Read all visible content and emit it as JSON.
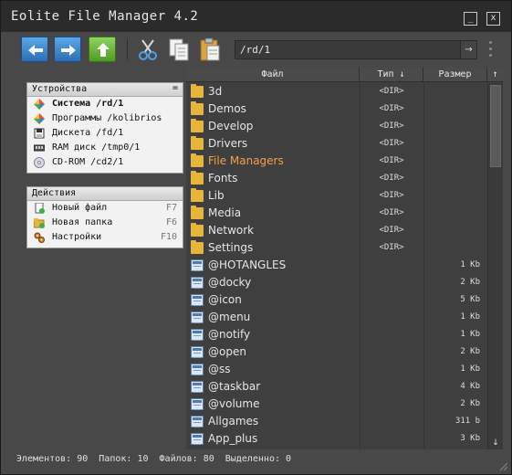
{
  "window": {
    "title": "Eolite File Manager 4.2",
    "minimize_label": "_",
    "close_label": "x"
  },
  "toolbar": {
    "path": "/rd/1",
    "go_label": "→"
  },
  "devices": {
    "header": "Устройства",
    "menu_label": "=",
    "items": [
      {
        "label": "Система /rd/1",
        "icon": "system-icon"
      },
      {
        "label": "Программы /kolibrios",
        "icon": "programs-icon"
      },
      {
        "label": "Дискета /fd/1",
        "icon": "floppy-icon"
      },
      {
        "label": "RAM диск /tmp0/1",
        "icon": "ramdisk-icon"
      },
      {
        "label": "CD-ROM /cd2/1",
        "icon": "cdrom-icon"
      }
    ]
  },
  "actions": {
    "header": "Действия",
    "items": [
      {
        "label": "Новый файл",
        "key": "F7",
        "icon": "new-file-icon"
      },
      {
        "label": "Новая папка",
        "key": "F6",
        "icon": "new-folder-icon"
      },
      {
        "label": "Настройки",
        "key": "F10",
        "icon": "settings-icon"
      }
    ]
  },
  "list": {
    "col_name": "Файл",
    "col_type": "Тип ↓",
    "col_size": "Размер",
    "scroll_up": "↑",
    "scroll_down": "↓",
    "rows": [
      {
        "name": "3d",
        "type": "<DIR>",
        "size": "",
        "kind": "folder"
      },
      {
        "name": "Demos",
        "type": "<DIR>",
        "size": "",
        "kind": "folder"
      },
      {
        "name": "Develop",
        "type": "<DIR>",
        "size": "",
        "kind": "folder"
      },
      {
        "name": "Drivers",
        "type": "<DIR>",
        "size": "",
        "kind": "folder"
      },
      {
        "name": "File Managers",
        "type": "<DIR>",
        "size": "",
        "kind": "folder"
      },
      {
        "name": "Fonts",
        "type": "<DIR>",
        "size": "",
        "kind": "folder"
      },
      {
        "name": "Lib",
        "type": "<DIR>",
        "size": "",
        "kind": "folder"
      },
      {
        "name": "Media",
        "type": "<DIR>",
        "size": "",
        "kind": "folder"
      },
      {
        "name": "Network",
        "type": "<DIR>",
        "size": "",
        "kind": "folder"
      },
      {
        "name": "Settings",
        "type": "<DIR>",
        "size": "",
        "kind": "folder"
      },
      {
        "name": "@HOTANGLES",
        "type": "",
        "size": "1 Kb",
        "kind": "file"
      },
      {
        "name": "@docky",
        "type": "",
        "size": "2 Kb",
        "kind": "file"
      },
      {
        "name": "@icon",
        "type": "",
        "size": "5 Kb",
        "kind": "file"
      },
      {
        "name": "@menu",
        "type": "",
        "size": "1 Kb",
        "kind": "file"
      },
      {
        "name": "@notify",
        "type": "",
        "size": "1 Kb",
        "kind": "file"
      },
      {
        "name": "@open",
        "type": "",
        "size": "2 Kb",
        "kind": "file"
      },
      {
        "name": "@ss",
        "type": "",
        "size": "1 Kb",
        "kind": "file"
      },
      {
        "name": "@taskbar",
        "type": "",
        "size": "4 Kb",
        "kind": "file"
      },
      {
        "name": "@volume",
        "type": "",
        "size": "2 Kb",
        "kind": "file"
      },
      {
        "name": "Allgames",
        "type": "",
        "size": "311 b",
        "kind": "file"
      },
      {
        "name": "App_plus",
        "type": "",
        "size": "3 Kb",
        "kind": "file"
      }
    ]
  },
  "status": {
    "text": "Элементов: 90  Папок: 10  Файлов: 80  Выделенно: 0"
  },
  "colors": {
    "highlight": "#f0a050",
    "folder": "#e8b53a",
    "background": "#484848"
  }
}
